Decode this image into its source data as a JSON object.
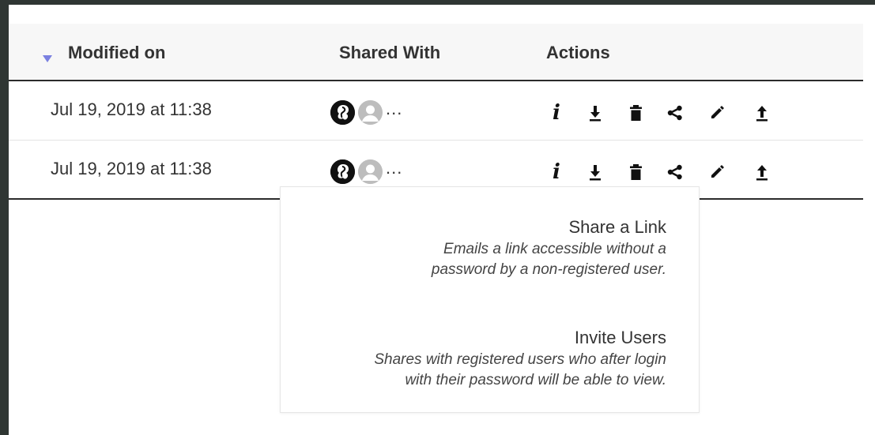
{
  "table": {
    "headers": {
      "modified_on": "Modified on",
      "shared_with": "Shared With",
      "actions": "Actions"
    },
    "sort": {
      "column": "modified_on",
      "direction": "descending",
      "indicator_color": "#7a80e0"
    },
    "rows": [
      {
        "modified": "Jul 19, 2019 at 11:38",
        "shared_more": "..."
      },
      {
        "modified": "Jul 19, 2019 at 11:38",
        "shared_more": "..."
      }
    ],
    "action_icons": [
      "info-icon",
      "download-icon",
      "trash-icon",
      "share-icon",
      "pencil-icon",
      "upload-icon"
    ],
    "info_glyph": "i"
  },
  "share_menu": {
    "options": [
      {
        "title": "Share a Link",
        "description_line1": "Emails a link accessible without a",
        "description_line2": "password by a non-registered user."
      },
      {
        "title": "Invite Users",
        "description_line1": "Shares with registered users who after login",
        "description_line2": "with their password will be able to view."
      }
    ]
  },
  "colors": {
    "frame": "#2f3633",
    "header_bg": "#f7f7f7",
    "text": "#333333",
    "icon": "#111111"
  }
}
